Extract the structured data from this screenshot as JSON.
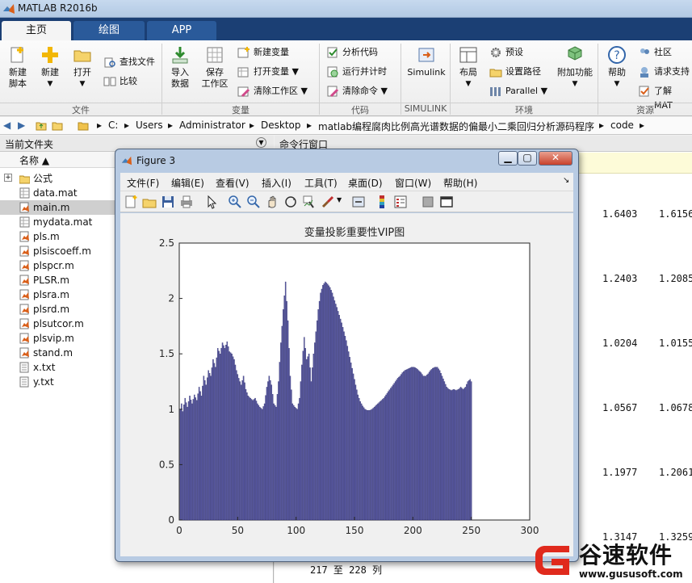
{
  "app": {
    "title": "MATLAB R2016b"
  },
  "tabs": [
    {
      "label": "主页"
    },
    {
      "label": "绘图"
    },
    {
      "label": "APP"
    }
  ],
  "ribbon": {
    "new_script": "新建\n脚本",
    "new": "新建",
    "open": "打开",
    "find_files": "查找文件",
    "compare": "比较",
    "import_data": "导入\n数据",
    "save_workspace": "保存\n工作区",
    "new_variable": "新建变量",
    "open_variable": "打开变量",
    "clear_workspace": "清除工作区",
    "analyze_code": "分析代码",
    "run_and_time": "运行并计时",
    "clear_commands": "清除命令",
    "simulink": "Simulink",
    "layout": "布局",
    "preferences": "预设",
    "set_path": "设置路径",
    "parallel": "Parallel",
    "add_ons": "附加功能",
    "help": "帮助",
    "community": "社区",
    "request_support": "请求支持",
    "learn_matlab": "了解 MAT",
    "groups": {
      "file": "文件",
      "variable": "变量",
      "code": "代码",
      "simulink": "SIMULINK",
      "environment": "环境",
      "resources": "资源"
    }
  },
  "address_bar": {
    "path": [
      "C:",
      "Users",
      "Administrator",
      "Desktop",
      "matlab编程腐肉比例高光谱数据的偏最小二乘回归分析源码程序",
      "code"
    ]
  },
  "current_folder": {
    "title": "当前文件夹",
    "column_name": "名称 ▲",
    "items": [
      {
        "name": "公式",
        "type": "folder"
      },
      {
        "name": "data.mat",
        "type": "mat"
      },
      {
        "name": "main.m",
        "type": "m"
      },
      {
        "name": "mydata.mat",
        "type": "mat"
      },
      {
        "name": "pls.m",
        "type": "m"
      },
      {
        "name": "plsiscoeff.m",
        "type": "m"
      },
      {
        "name": "plspcr.m",
        "type": "m"
      },
      {
        "name": "PLSR.m",
        "type": "m"
      },
      {
        "name": "plsra.m",
        "type": "m"
      },
      {
        "name": "plsrd.m",
        "type": "m"
      },
      {
        "name": "plsutcor.m",
        "type": "m"
      },
      {
        "name": "plsvip.m",
        "type": "m"
      },
      {
        "name": "stand.m",
        "type": "m"
      },
      {
        "name": "x.txt",
        "type": "txt"
      },
      {
        "name": "y.txt",
        "type": "txt"
      }
    ],
    "selected_index": 2
  },
  "command_window": {
    "title": "命令行窗口",
    "col1": [
      "1.6403",
      "1.2403",
      "1.0204",
      "1.0567",
      "1.1977",
      "1.3147"
    ],
    "col2": [
      "1.6156",
      "1.2085",
      "1.0155",
      "1.0678",
      "1.2061",
      "1.3259"
    ],
    "footer": "217 至 228 列"
  },
  "figure": {
    "window_title": "Figure 3",
    "menu": [
      "文件(F)",
      "编辑(E)",
      "查看(V)",
      "插入(I)",
      "工具(T)",
      "桌面(D)",
      "窗口(W)",
      "帮助(H)"
    ],
    "toolbar_icons": [
      "new-figure-icon",
      "open-icon",
      "save-icon",
      "print-icon",
      "pointer-icon",
      "zoom-in-icon",
      "zoom-out-icon",
      "pan-icon",
      "rotate-icon",
      "data-cursor-icon",
      "brush-icon",
      "link-icon",
      "colorbar-icon",
      "legend-icon",
      "hide-tools-icon",
      "dock-icon"
    ]
  },
  "chart_data": {
    "type": "bar",
    "title": "变量投影重要性VIP图",
    "xlabel": "",
    "ylabel": "",
    "xlim": [
      0,
      300
    ],
    "ylim": [
      0,
      2.5
    ],
    "xticks": [
      0,
      50,
      100,
      150,
      200,
      250,
      300
    ],
    "yticks": [
      0,
      0.5,
      1,
      1.5,
      2,
      2.5
    ],
    "bar_color": "#5a5aa3",
    "x": [
      1,
      250
    ],
    "anchors": [
      [
        1,
        1.0
      ],
      [
        2,
        1.05
      ],
      [
        3,
        0.98
      ],
      [
        5,
        1.1
      ],
      [
        7,
        1.02
      ],
      [
        9,
        1.12
      ],
      [
        11,
        1.05
      ],
      [
        13,
        1.13
      ],
      [
        15,
        1.08
      ],
      [
        17,
        1.2
      ],
      [
        19,
        1.12
      ],
      [
        21,
        1.3
      ],
      [
        23,
        1.22
      ],
      [
        25,
        1.35
      ],
      [
        27,
        1.3
      ],
      [
        29,
        1.45
      ],
      [
        31,
        1.38
      ],
      [
        33,
        1.55
      ],
      [
        35,
        1.5
      ],
      [
        37,
        1.6
      ],
      [
        39,
        1.55
      ],
      [
        41,
        1.61
      ],
      [
        43,
        1.52
      ],
      [
        45,
        1.5
      ],
      [
        47,
        1.45
      ],
      [
        49,
        1.35
      ],
      [
        51,
        1.28
      ],
      [
        53,
        1.22
      ],
      [
        55,
        1.3
      ],
      [
        57,
        1.18
      ],
      [
        59,
        1.12
      ],
      [
        61,
        1.1
      ],
      [
        63,
        1.08
      ],
      [
        65,
        1.1
      ],
      [
        67,
        1.05
      ],
      [
        69,
        1.02
      ],
      [
        71,
        1.0
      ],
      [
        73,
        1.05
      ],
      [
        75,
        1.2
      ],
      [
        77,
        1.3
      ],
      [
        79,
        1.22
      ],
      [
        81,
        1.05
      ],
      [
        83,
        1.02
      ],
      [
        85,
        1.25
      ],
      [
        87,
        1.6
      ],
      [
        89,
        1.9
      ],
      [
        91,
        2.15
      ],
      [
        93,
        1.8
      ],
      [
        95,
        1.3
      ],
      [
        97,
        1.05
      ],
      [
        99,
        1.02
      ],
      [
        101,
        1.0
      ],
      [
        103,
        1.1
      ],
      [
        105,
        1.4
      ],
      [
        107,
        1.65
      ],
      [
        109,
        1.45
      ],
      [
        111,
        1.5
      ],
      [
        113,
        1.25
      ],
      [
        115,
        1.5
      ],
      [
        117,
        1.7
      ],
      [
        119,
        1.9
      ],
      [
        121,
        2.05
      ],
      [
        123,
        2.12
      ],
      [
        125,
        2.15
      ],
      [
        127,
        2.13
      ],
      [
        129,
        2.1
      ],
      [
        131,
        2.05
      ],
      [
        133,
        1.98
      ],
      [
        135,
        1.92
      ],
      [
        137,
        1.85
      ],
      [
        139,
        1.78
      ],
      [
        141,
        1.7
      ],
      [
        143,
        1.62
      ],
      [
        145,
        1.52
      ],
      [
        147,
        1.42
      ],
      [
        149,
        1.32
      ],
      [
        151,
        1.22
      ],
      [
        153,
        1.13
      ],
      [
        155,
        1.07
      ],
      [
        157,
        1.03
      ],
      [
        159,
        1.0
      ],
      [
        161,
        0.99
      ],
      [
        163,
        0.99
      ],
      [
        165,
        1.0
      ],
      [
        167,
        1.02
      ],
      [
        169,
        1.04
      ],
      [
        171,
        1.06
      ],
      [
        173,
        1.08
      ],
      [
        175,
        1.1
      ],
      [
        177,
        1.13
      ],
      [
        179,
        1.16
      ],
      [
        181,
        1.19
      ],
      [
        183,
        1.22
      ],
      [
        185,
        1.25
      ],
      [
        187,
        1.28
      ],
      [
        189,
        1.3
      ],
      [
        191,
        1.33
      ],
      [
        193,
        1.35
      ],
      [
        195,
        1.36
      ],
      [
        197,
        1.37
      ],
      [
        199,
        1.38
      ],
      [
        201,
        1.38
      ],
      [
        203,
        1.37
      ],
      [
        205,
        1.35
      ],
      [
        207,
        1.33
      ],
      [
        209,
        1.3
      ],
      [
        211,
        1.3
      ],
      [
        213,
        1.32
      ],
      [
        215,
        1.35
      ],
      [
        217,
        1.37
      ],
      [
        219,
        1.38
      ],
      [
        221,
        1.38
      ],
      [
        223,
        1.35
      ],
      [
        225,
        1.3
      ],
      [
        227,
        1.25
      ],
      [
        229,
        1.2
      ],
      [
        231,
        1.18
      ],
      [
        233,
        1.17
      ],
      [
        235,
        1.18
      ],
      [
        237,
        1.17
      ],
      [
        239,
        1.18
      ],
      [
        241,
        1.2
      ],
      [
        243,
        1.18
      ],
      [
        245,
        1.2
      ],
      [
        247,
        1.25
      ],
      [
        249,
        1.27
      ],
      [
        250,
        1.25
      ]
    ]
  },
  "watermark": {
    "brand": "谷速软件",
    "url": "www.gususoft.com"
  }
}
